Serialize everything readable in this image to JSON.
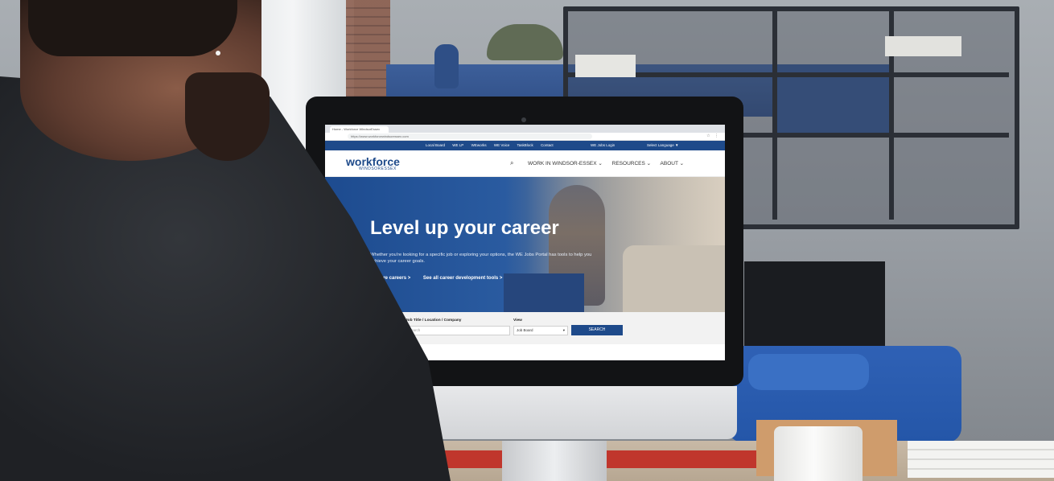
{
  "browser": {
    "tab_title": "Home - Workforce WindsorEssex",
    "address": "https://www.workforcewindsoressex.com",
    "toolbar_icons": "☆ ⋮"
  },
  "site": {
    "topbar": {
      "links": [
        "Local Board",
        "WE LP",
        "WEworks",
        "WE Voice",
        "TaskBlock",
        "Contact"
      ],
      "login": "WE Jobs Login",
      "language": "Select Language ▼"
    },
    "logo": {
      "main": "workforce",
      "sub": "WINDSORESSEX"
    },
    "nav": {
      "search_icon": "⌕",
      "items": [
        "WORK IN WINDSOR-ESSEX ⌄",
        "RESOURCES ⌄",
        "ABOUT ⌄"
      ]
    },
    "hero": {
      "title": "Level up your career",
      "text": "Whether you're looking for a specific job or exploring your options, the WE Jobs Portal has tools to help you achieve your career goals.",
      "link_explore": "Explore careers >",
      "link_tools": "See all career development tools >"
    },
    "search": {
      "label_query": "Job Title / Location / Company",
      "placeholder": "Search",
      "label_view": "View",
      "view_value": "Job Board",
      "view_chevron": "▾",
      "button": "SEARCH"
    }
  }
}
